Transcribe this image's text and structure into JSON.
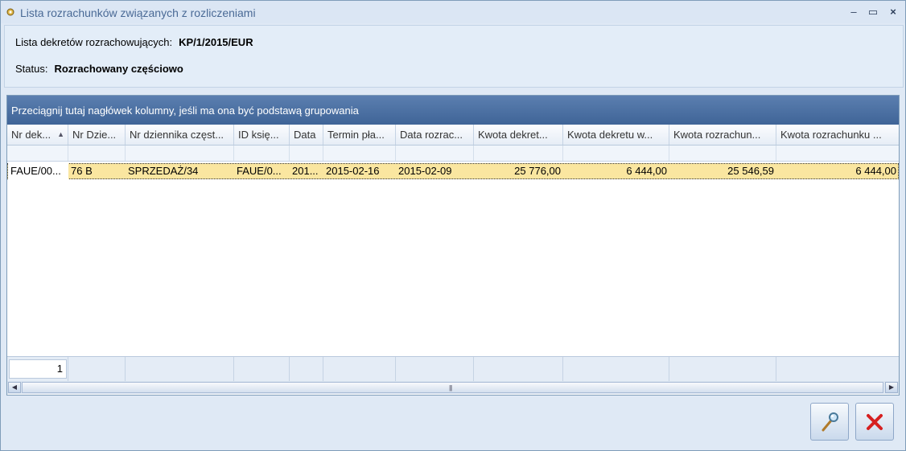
{
  "window": {
    "title": "Lista rozrachunków związanych z rozliczeniami",
    "controls": {
      "minimize": "–",
      "maximize": "▭",
      "close": "×"
    }
  },
  "info": {
    "decree_label": "Lista dekretów rozrachowujących:",
    "decree_value": "KP/1/2015/EUR",
    "status_label": "Status:",
    "status_value": "Rozrachowany częściowo"
  },
  "grid": {
    "group_hint": "Przeciągnij tutaj nagłówek kolumny, jeśli ma ona być podstawą grupowania",
    "columns": [
      "Nr dek...",
      "Nr Dzie...",
      "Nr dziennika częst...",
      "ID księ...",
      "Data",
      "Termin pła...",
      "Data rozrac...",
      "Kwota dekret...",
      "Kwota dekretu w...",
      "Kwota rozrachun...",
      "Kwota rozrachunku ..."
    ],
    "sort_indicator": "▲",
    "rows": [
      [
        "FAUE/00...",
        "76 B",
        "SPRZEDAŻ/34",
        "FAUE/0...",
        "201...",
        "2015-02-16",
        "2015-02-09",
        "25 776,00",
        "6 444,00",
        "25 546,59",
        "6 444,00"
      ]
    ],
    "footer_count": "1",
    "scroll_grip": "|||"
  },
  "icons": {
    "preview": "magnifier-icon",
    "cancel": "red-x-icon"
  },
  "colors": {
    "selected_row": "#fae6a0",
    "group_panel": "#4a6fa5",
    "cancel_red": "#d62020"
  }
}
